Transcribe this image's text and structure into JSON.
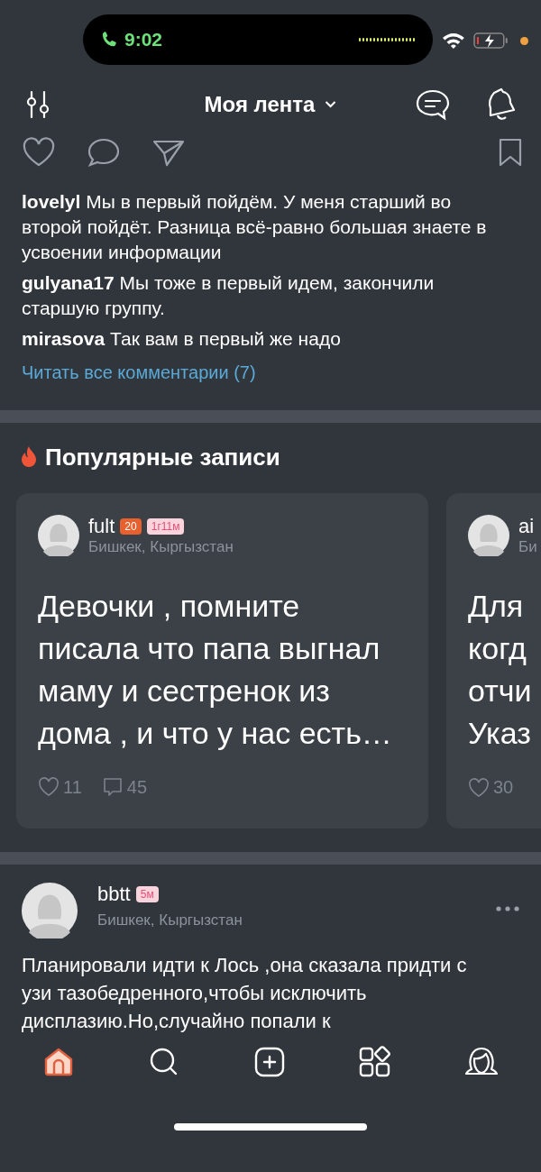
{
  "status_bar": {
    "time": "9:02"
  },
  "header": {
    "title": "Моя лента"
  },
  "comments": [
    {
      "user": "lovelyl",
      "text": "Мы в первый пойдём. У меня старший во второй пойдёт. Разница всё-равно большая знаете в усвоении информации"
    },
    {
      "user": "gulyana17",
      "text": "Мы тоже в первый идем, закончили старшую группу."
    },
    {
      "user": "mirasova",
      "text": "Так вам в первый же надо"
    }
  ],
  "read_all_link": "Читать все комментарии (7)",
  "popular": {
    "title": "Популярные записи",
    "cards": [
      {
        "user": "fult",
        "level_badge": "20",
        "age_badge": "1г11м",
        "location": "Бишкек, Кыргызстан",
        "text": "Девочки , помните писала что папа выгнал маму и сестренок из дома , и что у нас есть…",
        "likes": "11",
        "comments": "45"
      },
      {
        "user": "ai",
        "location": "Би",
        "lines": [
          "Для",
          "когд",
          "отчи",
          "Указ"
        ],
        "likes": "30"
      }
    ]
  },
  "post": {
    "user": "bbtt",
    "age_badge": "5м",
    "location": "Бишкек, Кыргызстан",
    "text": "Планировали идти к Лось ,она сказала придти с узи тазобедренного,чтобы исключить дисплазию.Но,случайно попали к"
  },
  "tab_bar": [
    {
      "kind": "home",
      "selected": true
    },
    {
      "kind": "search",
      "selected": false
    },
    {
      "kind": "add",
      "selected": false
    },
    {
      "kind": "apps",
      "selected": false
    },
    {
      "kind": "profile",
      "selected": false
    }
  ]
}
